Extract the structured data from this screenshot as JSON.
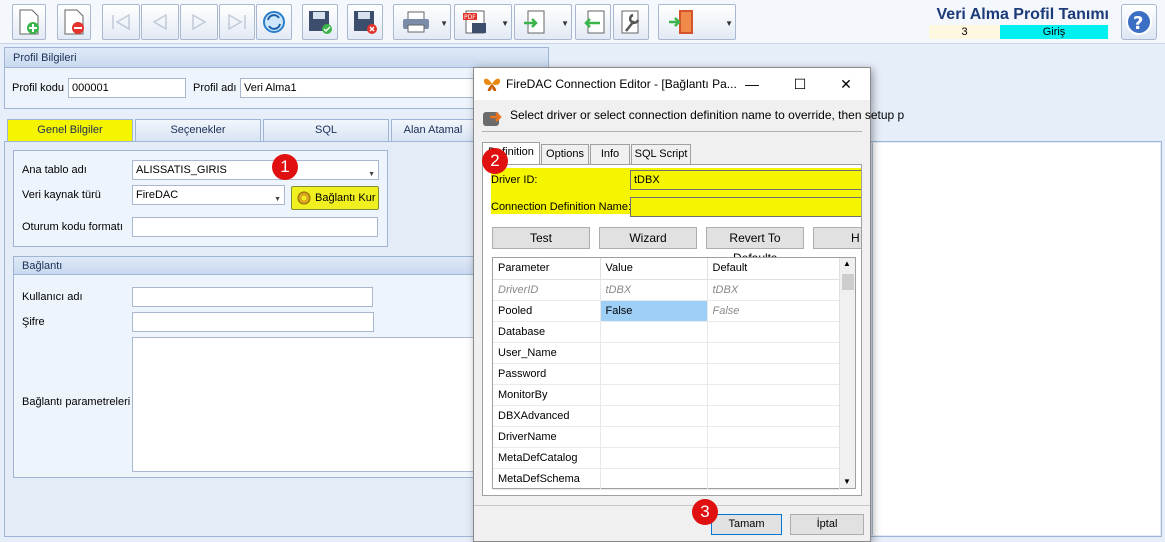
{
  "header": {
    "title": "Veri Alma Profil Tanımı",
    "record_no": "3",
    "mode": "Giriş",
    "mode_color": "#00f0f0"
  },
  "toolbar": {
    "buttons": [
      "new-record-icon",
      "delete-record-icon",
      "first-record-icon",
      "prev-record-icon",
      "next-record-icon",
      "last-record-icon",
      "refresh-icon",
      "save-icon",
      "cancel-icon",
      "print-icon",
      "pdf-icon",
      "export-icon",
      "import-icon",
      "tools-icon",
      "exit-icon"
    ]
  },
  "profile": {
    "group_title": "Profil Bilgileri",
    "code_label": "Profil kodu",
    "code_value": "000001",
    "name_label": "Profil adı",
    "name_value": "Veri Alma1"
  },
  "tabs": [
    {
      "label": "Genel Bilgiler",
      "active": true
    },
    {
      "label": "Seçenekler",
      "active": false
    },
    {
      "label": "SQL",
      "active": false
    },
    {
      "label": "Alan Atamal",
      "active": false
    }
  ],
  "general": {
    "main_table_label": "Ana tablo adı",
    "main_table_value": "ALISSATIS_GIRIS",
    "source_type_label": "Veri kaynak türü",
    "source_type_value": "FireDAC",
    "connect_button": "Bağlantı Kur",
    "session_format_label": "Oturum kodu formatı",
    "session_format_value": ""
  },
  "connection": {
    "group_title": "Bağlantı",
    "user_label": "Kullanıcı adı",
    "password_label": "Şifre",
    "params_label": "Bağlantı parametreleri"
  },
  "dialog": {
    "title": "FireDAC Connection Editor - [Bağlantı Pa...",
    "subtitle": "Select driver or select connection definition name to override, then setup p",
    "tabs": [
      "Definition",
      "Options",
      "Info",
      "SQL Script"
    ],
    "driver_id_label": "Driver ID:",
    "driver_id_value": "tDBX",
    "conn_def_label": "Connection Definition Name:",
    "conn_def_value": "",
    "buttons": {
      "test": "Test",
      "wizard": "Wizard",
      "revert": "Revert To Defaults",
      "help": "H"
    },
    "grid": {
      "columns": [
        "Parameter",
        "Value",
        "Default"
      ],
      "rows": [
        [
          "DriverID",
          "tDBX",
          "tDBX"
        ],
        [
          "Pooled",
          "False",
          "False"
        ],
        [
          "Database",
          "",
          ""
        ],
        [
          "User_Name",
          "",
          ""
        ],
        [
          "Password",
          "",
          ""
        ],
        [
          "MonitorBy",
          "",
          ""
        ],
        [
          "DBXAdvanced",
          "",
          ""
        ],
        [
          "DriverName",
          "",
          ""
        ],
        [
          "MetaDefCatalog",
          "",
          ""
        ],
        [
          "MetaDefSchema",
          "",
          ""
        ]
      ]
    },
    "ok": "Tamam",
    "cancel": "İptal"
  },
  "markers": [
    "1",
    "2",
    "3"
  ],
  "colors": {
    "highlight": "#f5f500",
    "marker": "#e01010",
    "selection": "#9dcff7"
  }
}
